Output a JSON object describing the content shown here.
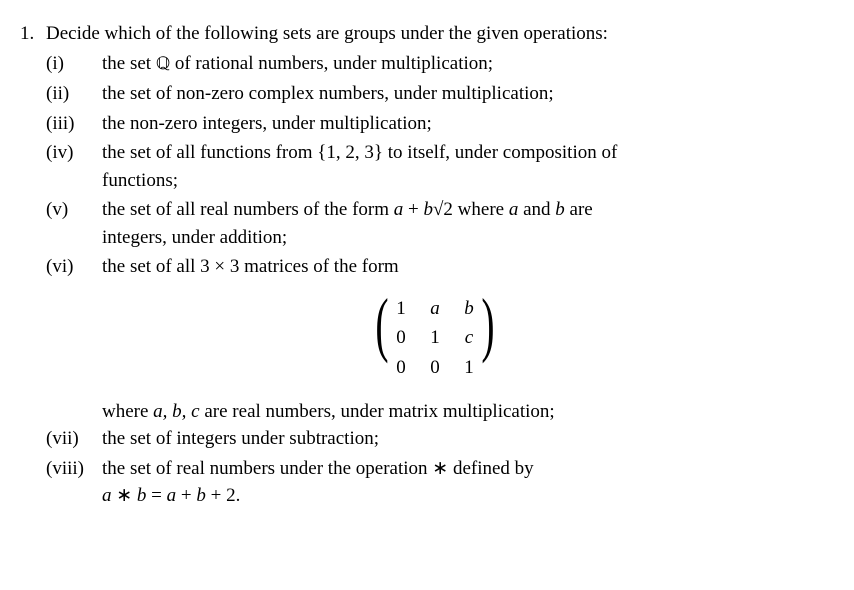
{
  "problem": {
    "number": "1.",
    "intro": "Decide which of the following sets are groups under the given operations:",
    "items": {
      "i": {
        "num": "(i)",
        "text_a": "the set ",
        "sym": "ℚ",
        "text_b": " of rational numbers, under multiplication;"
      },
      "ii": {
        "num": "(ii)",
        "text": "the set of non-zero complex numbers, under multiplication;"
      },
      "iii": {
        "num": "(iii)",
        "text": "the non-zero integers, under multiplication;"
      },
      "iv": {
        "num": "(iv)",
        "line1": "the set of all functions from {1, 2, 3} to itself, under composition of",
        "line2": "functions;"
      },
      "v": {
        "num": "(v)",
        "line1_pre": "the set of all real numbers of the form ",
        "a": "a",
        "plus": " + ",
        "b": "b",
        "sqrt": "√2",
        "line1_post": " where ",
        "a2": "a",
        "and": " and ",
        "b2": "b",
        "are": " are",
        "line2": "integers, under addition;"
      },
      "vi": {
        "num": "(vi)",
        "line1": "the set of all 3 × 3 matrices of the form",
        "matrix": {
          "r1c1": "1",
          "r1c2": "a",
          "r1c3": "b",
          "r2c1": "0",
          "r2c2": "1",
          "r2c3": "c",
          "r3c1": "0",
          "r3c2": "0",
          "r3c3": "1"
        },
        "after_pre": "where ",
        "vars": "a, b, c",
        "after_post": " are real numbers, under matrix multiplication;"
      },
      "vii": {
        "num": "(vii)",
        "text": "the set of integers under subtraction;"
      },
      "viii": {
        "num": "(viii)",
        "line1": "the set of real numbers under the operation ∗ defined by",
        "eq_a": "a",
        "eq_s1": " ∗ ",
        "eq_b": "b",
        "eq_eq": " = ",
        "eq_a2": "a",
        "eq_p1": " + ",
        "eq_b2": "b",
        "eq_p2": " + 2."
      }
    }
  }
}
